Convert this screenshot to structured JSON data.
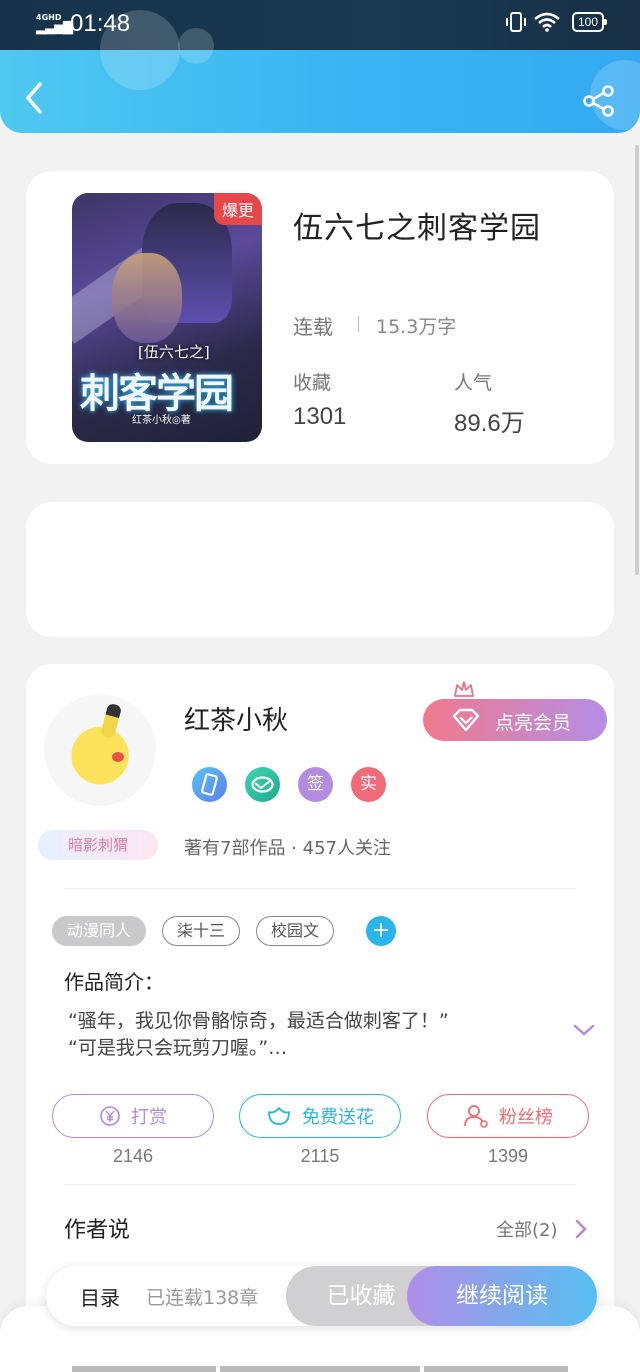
{
  "status_bar": {
    "network": "4GHD",
    "time": "01:48",
    "battery": "100"
  },
  "book": {
    "title": "伍六七之刺客学园",
    "status": "连载",
    "word_count": "15.3万字",
    "badge": "爆更",
    "cover": {
      "subtitle": "[伍六七之]",
      "title": "刺客学园",
      "author": "红茶小秋◎著"
    },
    "stats": [
      {
        "label": "收藏",
        "value": "1301"
      },
      {
        "label": "人气",
        "value": "89.6万"
      }
    ]
  },
  "author": {
    "name": "红茶小秋",
    "tag": "暗影刺猬",
    "vip_label": "点亮会员",
    "meta": "著有7部作品 · 457人关注",
    "badges": [
      {
        "icon": "phone-badge-icon",
        "text": "",
        "color": "#4a8ff0"
      },
      {
        "icon": "handshake-badge-icon",
        "text": "",
        "color": "#2ec6a6"
      },
      {
        "icon": "sign-badge",
        "text": "签",
        "color": "#b38be0"
      },
      {
        "icon": "real-badge",
        "text": "实",
        "color": "#f06a78"
      }
    ]
  },
  "tags": [
    "动漫同人",
    "柒十三",
    "校园文"
  ],
  "intro": {
    "label": "作品简介：",
    "line1": "“骚年，我见你骨骼惊奇，最适合做刺客了！”",
    "line2": "“可是我只会玩剪刀喔。”…"
  },
  "actions": [
    {
      "label": "打赏",
      "count": "2146",
      "color": "#b48ad8",
      "icon": "yen-icon"
    },
    {
      "label": "免费送花",
      "count": "2115",
      "color": "#2ab6d6",
      "icon": "flower-icon"
    },
    {
      "label": "粉丝榜",
      "count": "1399",
      "color": "#ea6c70",
      "icon": "fans-icon"
    }
  ],
  "author_says": {
    "label": "作者说",
    "all": "全部(2)"
  },
  "bottom": {
    "toc": "目录",
    "serial": "已连载138章",
    "collected": "已收藏",
    "continue": "继续阅读"
  }
}
